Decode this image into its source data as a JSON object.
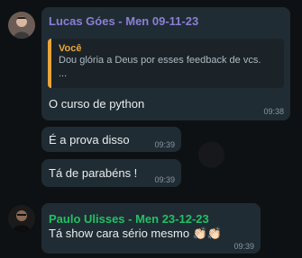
{
  "colors": {
    "sender_lucas": "#8b7fd6",
    "sender_paulo": "#21c063",
    "quote_accent": "#e9a53b",
    "bubble": "#202c33"
  },
  "messages": [
    {
      "sender": "Lucas Góes - Men 09-11-23",
      "quote": {
        "author": "Você",
        "text": "Dou glória a Deus por esses feedback de vcs.\n..."
      },
      "text": "O curso de python",
      "time": "09:38"
    },
    {
      "text": "É a prova disso",
      "time": "09:39"
    },
    {
      "text": "Tá de parabéns !",
      "time": "09:39"
    },
    {
      "sender": "Paulo Ulisses - Men 23-12-23",
      "text": "Tá show cara sério mesmo 👏🏻👏🏻",
      "time": "09:39"
    }
  ]
}
